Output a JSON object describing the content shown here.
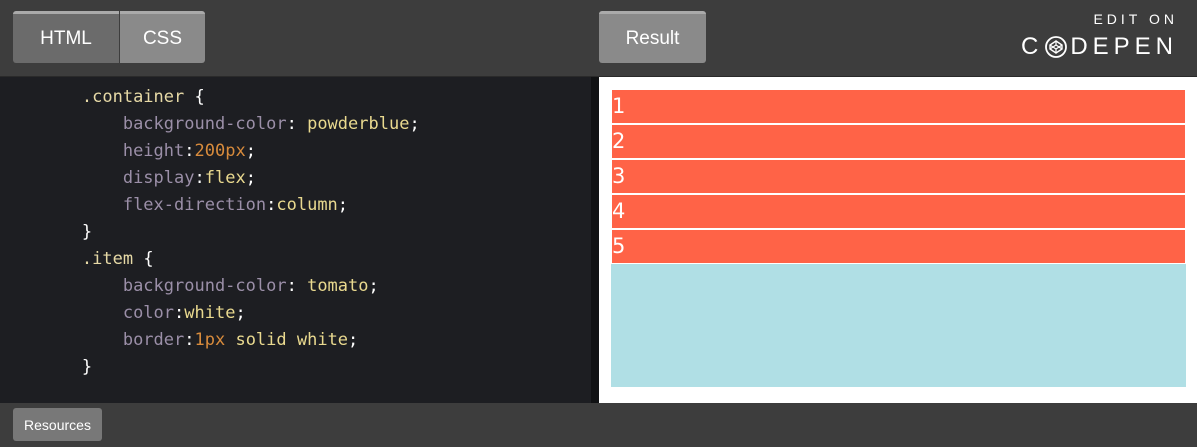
{
  "tabs": {
    "html": "HTML",
    "css": "CSS",
    "result": "Result"
  },
  "brand": {
    "edit_on": "EDIT ON",
    "name_left": "C",
    "name_right": "DEPEN",
    "logo_icon": "codepen-logo-icon"
  },
  "code": {
    "container_selector": ".container",
    "item_selector": ".item",
    "open_brace": " {",
    "close_brace": "}",
    "lines": [
      {
        "prop": "background-color",
        "sep": ": ",
        "val": "powderblue",
        "end": ";"
      },
      {
        "prop": "height",
        "sep": ":",
        "num": "200px",
        "end": ";"
      },
      {
        "prop": "display",
        "sep": ":",
        "val": "flex",
        "end": ";"
      },
      {
        "prop": "flex-direction",
        "sep": ":",
        "val": "column",
        "end": ";"
      },
      {
        "prop": "background-color",
        "sep": ": ",
        "val": "tomato",
        "end": ";"
      },
      {
        "prop": "color",
        "sep": ":",
        "val": "white",
        "end": ";"
      },
      {
        "prop": "border",
        "sep": ":",
        "num": "1px",
        "val2": " solid white",
        "end": ";"
      }
    ]
  },
  "result": {
    "items": [
      "1",
      "2",
      "3",
      "4",
      "5"
    ],
    "item_color": "#ff6347",
    "container_color": "#b0dfe5"
  },
  "footer": {
    "resources": "Resources"
  }
}
